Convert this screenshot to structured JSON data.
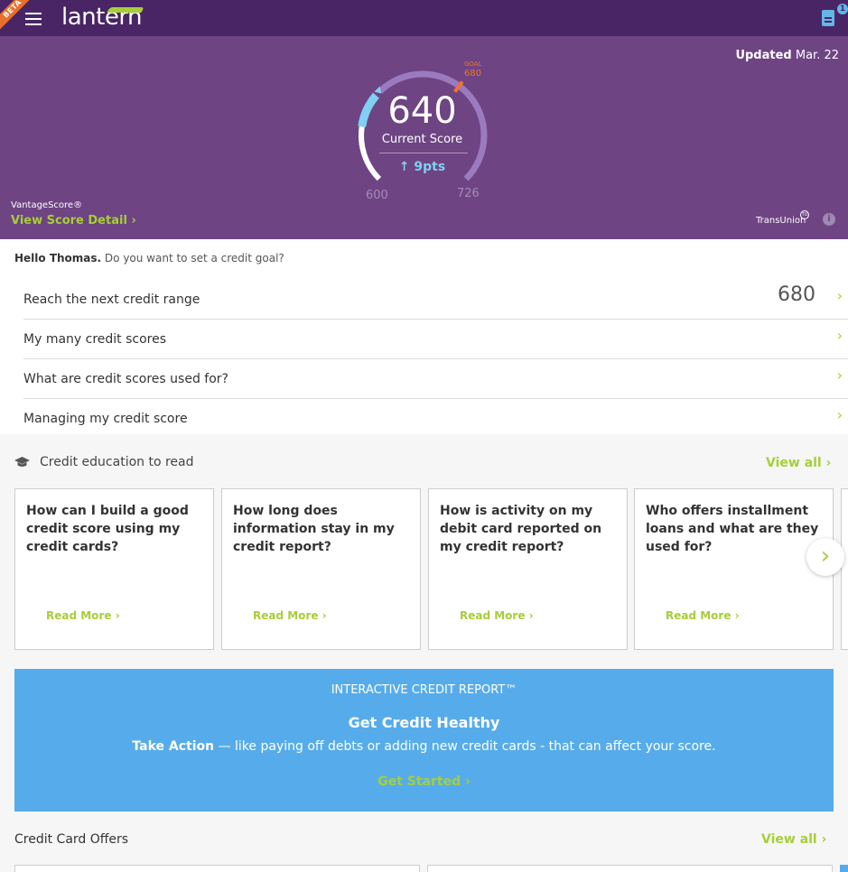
{
  "header": {
    "beta_label": "BETA",
    "logo_text": "lantern",
    "notification_count": "1"
  },
  "hero": {
    "updated_label": "Updated",
    "updated_date": "Mar. 22",
    "score": "640",
    "score_label": "Current Score",
    "score_change": "↑ 9pts",
    "range_min": "600",
    "range_max": "726",
    "goal_label": "GOAL",
    "goal_value": "680",
    "vantage_label": "VantageScore®",
    "view_detail_label": "View Score Detail",
    "bureau_label": "TransUnion",
    "bureau_mark": "TU",
    "info_glyph": "i"
  },
  "greeting": {
    "name": "Hello Thomas.",
    "question": " Do you want to set a credit goal?"
  },
  "goals": [
    {
      "label": "Reach the next credit range",
      "value": "680"
    },
    {
      "label": "My many credit scores",
      "value": ""
    },
    {
      "label": "What are credit scores used for?",
      "value": ""
    },
    {
      "label": "Managing my credit score",
      "value": ""
    }
  ],
  "education": {
    "title": "Credit education to read",
    "view_all": "View all",
    "cards": [
      {
        "question": "How can I build a good credit score using my credit cards?",
        "cta": "Read More"
      },
      {
        "question": "How long does information stay in my credit report?",
        "cta": "Read More"
      },
      {
        "question": "How is activity on my debit card reported on my credit report?",
        "cta": "Read More"
      },
      {
        "question": "Who offers installment loans and what are they used for?",
        "cta": "Read More"
      }
    ]
  },
  "banner": {
    "eyebrow": "INTERACTIVE CREDIT REPORT™",
    "heading": "Get Credit Healthy",
    "body_bold": "Take Action",
    "body_rest": " — like paying off debts or adding new credit cards - that can affect your score.",
    "cta": "Get Started"
  },
  "offers": {
    "title": "Credit Card Offers",
    "view_all": "View all"
  },
  "icons": {
    "menu": "hamburger-icon",
    "document": "document-icon",
    "chevron": "chevron-right-icon",
    "education": "graduation-cap-icon",
    "info": "info-icon",
    "up": "arrow-up-icon"
  },
  "colors": {
    "header_bg": "#4a2565",
    "hero_bg": "#6e4483",
    "accent_green": "#a6ce39",
    "accent_blue": "#56acea",
    "goal_orange": "#f0742b"
  },
  "score_gauge": {
    "min": 600,
    "max": 726,
    "current": 640,
    "goal": 680
  }
}
